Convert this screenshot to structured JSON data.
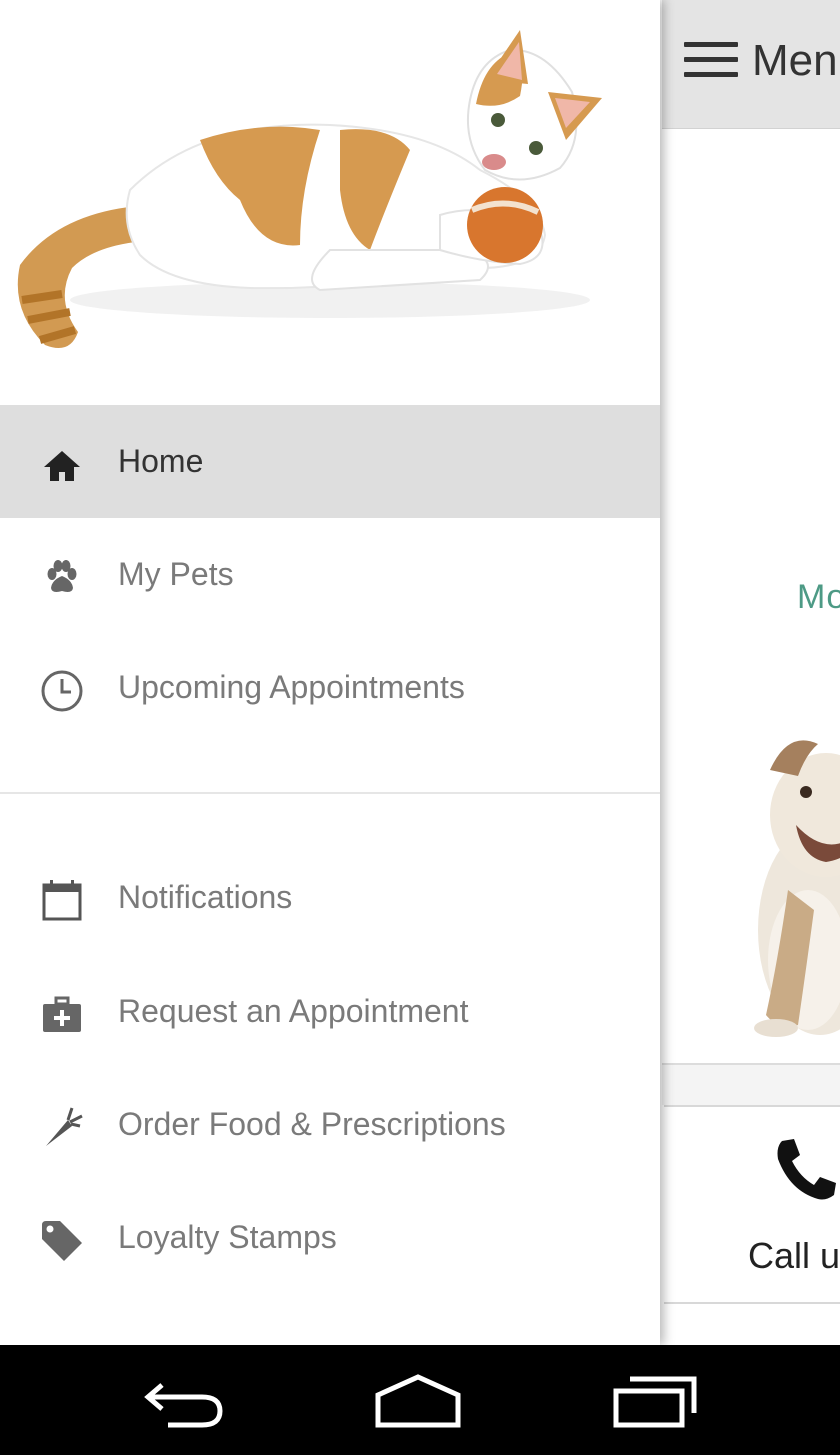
{
  "app": {
    "toolbar": {
      "menu_label": "Men"
    },
    "content": {
      "more_link": "Mo"
    },
    "call_card": {
      "label": "Call u"
    },
    "accent_color": "#4d9a85"
  },
  "drawer": {
    "items": [
      {
        "label": "Home",
        "icon": "home-icon",
        "active": true
      },
      {
        "label": "My Pets",
        "icon": "paw-icon",
        "active": false
      },
      {
        "label": "Upcoming Appointments",
        "icon": "clock-icon",
        "active": false
      },
      {
        "label": "Notifications",
        "icon": "calendar-icon",
        "active": false
      },
      {
        "label": "Request an Appointment",
        "icon": "medical-bag-icon",
        "active": false
      },
      {
        "label": "Order Food & Prescriptions",
        "icon": "carrot-icon",
        "active": false
      },
      {
        "label": "Loyalty Stamps",
        "icon": "tag-icon",
        "active": false
      }
    ]
  },
  "navbar": {
    "buttons": [
      "back-icon",
      "home-icon",
      "recent-apps-icon"
    ]
  }
}
